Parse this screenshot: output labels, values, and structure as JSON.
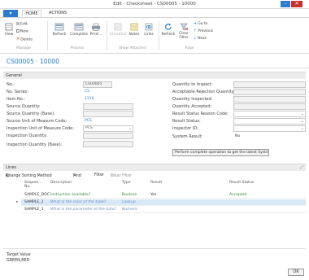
{
  "window": {
    "title": "Edit - Checksheet - CS00005 - 10000"
  },
  "tabs": {
    "menu": "▾",
    "home": "HOME",
    "actions": "ACTIONS"
  },
  "ribbon": {
    "view": "View",
    "edit": "Edit",
    "new": "New",
    "delete": "Delete",
    "refresh": "Refresh",
    "complete": "Complete",
    "print": "Print...",
    "checklist": "Checklist",
    "notes": "Notes",
    "links": "Links",
    "refresh2": "Refresh",
    "clear_filter": "Clear Filter",
    "goto": "Go to",
    "previous": "Previous",
    "next": "Next",
    "groups": {
      "manage": "Manage",
      "process": "Process",
      "show_attached": "Show Attached",
      "page": "Page"
    }
  },
  "page": {
    "title": "CS00005 · 10000"
  },
  "general": {
    "header": "General",
    "no_label": "No.:",
    "no_value": "CS00005",
    "no_series_label": "No. Series:",
    "no_series_value": "CS",
    "item_no_label": "Item No.:",
    "item_no_value": "1110",
    "source_qty_label": "Source Quantity:",
    "source_qty_base_label": "Source Quantity (Base):",
    "source_uom_label": "Source Unit of Measure Code:",
    "source_uom_value": "PCS",
    "insp_uom_label": "Inspection Unit of Measure Code:",
    "insp_uom_value": "PCS",
    "insp_qty_label": "Inspection Quantity:",
    "insp_qty_base_label": "Inspection Quantity (Base):",
    "qty_to_inspect_label": "Quantity to Inspect:",
    "accept_reject_label": "Acceptable Rejection Quantity:",
    "qty_inspected_label": "Quantity Inspected:",
    "qty_accepted_label": "Quantity Accepted:",
    "result_reason_label": "Result Status Reason Code:",
    "result_status_label": "Result Status:",
    "inspector_label": "Inspector ID:",
    "system_result_label": "System Result:",
    "system_result_value": "No",
    "perform_button": "Perform complete operation to get the latest Syste..."
  },
  "lines": {
    "header": "Lines",
    "change_sort": "Change Sorting Method",
    "find": "Find",
    "filter": "Filter",
    "clear_filter": "Clear Filter",
    "columns": {
      "sequence": "Sequen...",
      "no": "No.",
      "description": "Description",
      "type": "Type",
      "result": "Result",
      "result_status": "Result Status"
    },
    "rows": [
      {
        "sequence": "SAMPLE_DOC",
        "description": "Instruction available?",
        "type": "Boolean",
        "result": "Yes",
        "result_status": "Accepted"
      },
      {
        "sequence": "SAMPLE_1",
        "description": "What is the color of the tube?",
        "type": "Lookup",
        "result": "",
        "result_status": ""
      },
      {
        "sequence": "SAMPLE_1",
        "description": "What is the parameter of the tube?",
        "type": "Numeric",
        "result": "",
        "result_status": ""
      }
    ]
  },
  "footer": {
    "target_label": "Target Value",
    "target_value": "GREEN,RED",
    "ok": "OK"
  }
}
